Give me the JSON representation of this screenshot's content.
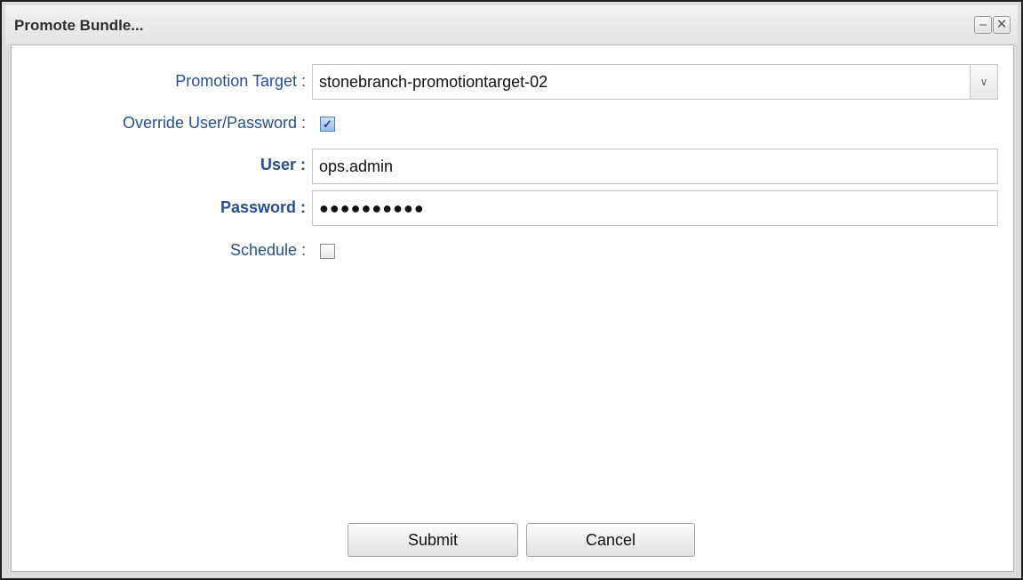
{
  "dialog": {
    "title": "Promote Bundle...",
    "minimize_glyph": "–",
    "close_glyph": "✕"
  },
  "form": {
    "promotion_target": {
      "label": "Promotion Target :",
      "value": "stonebranch-promotiontarget-02",
      "dropdown_glyph": "∨"
    },
    "override": {
      "label": "Override User/Password :",
      "checked": true,
      "check_glyph": "✓"
    },
    "user": {
      "label": "User :",
      "value": "ops.admin"
    },
    "password": {
      "label": "Password :",
      "masked_value": "●●●●●●●●●●"
    },
    "schedule": {
      "label": "Schedule :",
      "checked": false
    }
  },
  "buttons": {
    "submit": "Submit",
    "cancel": "Cancel"
  },
  "colors": {
    "label_blue": "#284f8d",
    "frame_border": "#1f1f1f"
  }
}
